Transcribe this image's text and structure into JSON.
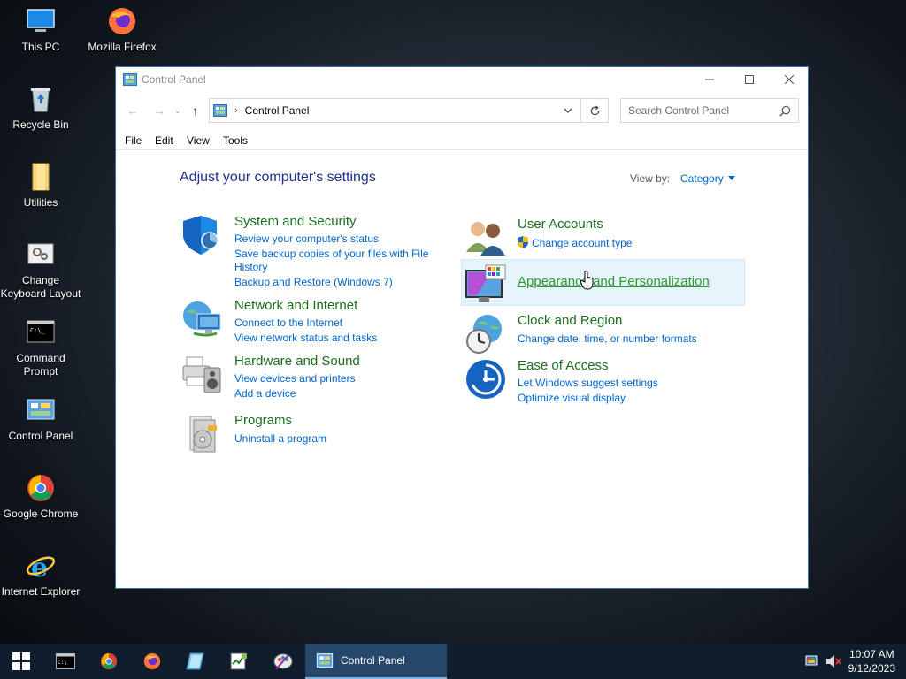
{
  "desktop": {
    "icons": [
      {
        "label": "This PC"
      },
      {
        "label": "Mozilla Firefox"
      },
      {
        "label": "Recycle Bin"
      },
      {
        "label": "Utilities"
      },
      {
        "label": "Change Keyboard Layout"
      },
      {
        "label": "Command Prompt"
      },
      {
        "label": "Control Panel"
      },
      {
        "label": "Google Chrome"
      },
      {
        "label": "Internet Explorer"
      }
    ]
  },
  "window": {
    "title": "Control Panel",
    "address_text": "Control Panel",
    "search_placeholder": "Search Control Panel",
    "menu": [
      "File",
      "Edit",
      "View",
      "Tools"
    ],
    "heading": "Adjust your computer's settings",
    "view_by_label": "View by:",
    "view_by_value": "Category",
    "categories_left": [
      {
        "title": "System and Security",
        "links": [
          "Review your computer's status",
          "Save backup copies of your files with File History",
          "Backup and Restore (Windows 7)"
        ]
      },
      {
        "title": "Network and Internet",
        "links": [
          "Connect to the Internet",
          "View network status and tasks"
        ]
      },
      {
        "title": "Hardware and Sound",
        "links": [
          "View devices and printers",
          "Add a device"
        ]
      },
      {
        "title": "Programs",
        "links": [
          "Uninstall a program"
        ]
      }
    ],
    "categories_right": [
      {
        "title": "User Accounts",
        "links": [
          "Change account type"
        ]
      },
      {
        "title": "Appearance and Personalization",
        "links": []
      },
      {
        "title": "Clock and Region",
        "links": [
          "Change date, time, or number formats"
        ]
      },
      {
        "title": "Ease of Access",
        "links": [
          "Let Windows suggest settings",
          "Optimize visual display"
        ]
      }
    ]
  },
  "taskbar": {
    "active_window": "Control Panel",
    "time": "10:07 AM",
    "date": "9/12/2023"
  },
  "colors": {
    "accent": "#0066cc",
    "category_title": "#1b6e1b",
    "heading": "#1e3287",
    "taskbar": "#0f1d2c"
  }
}
